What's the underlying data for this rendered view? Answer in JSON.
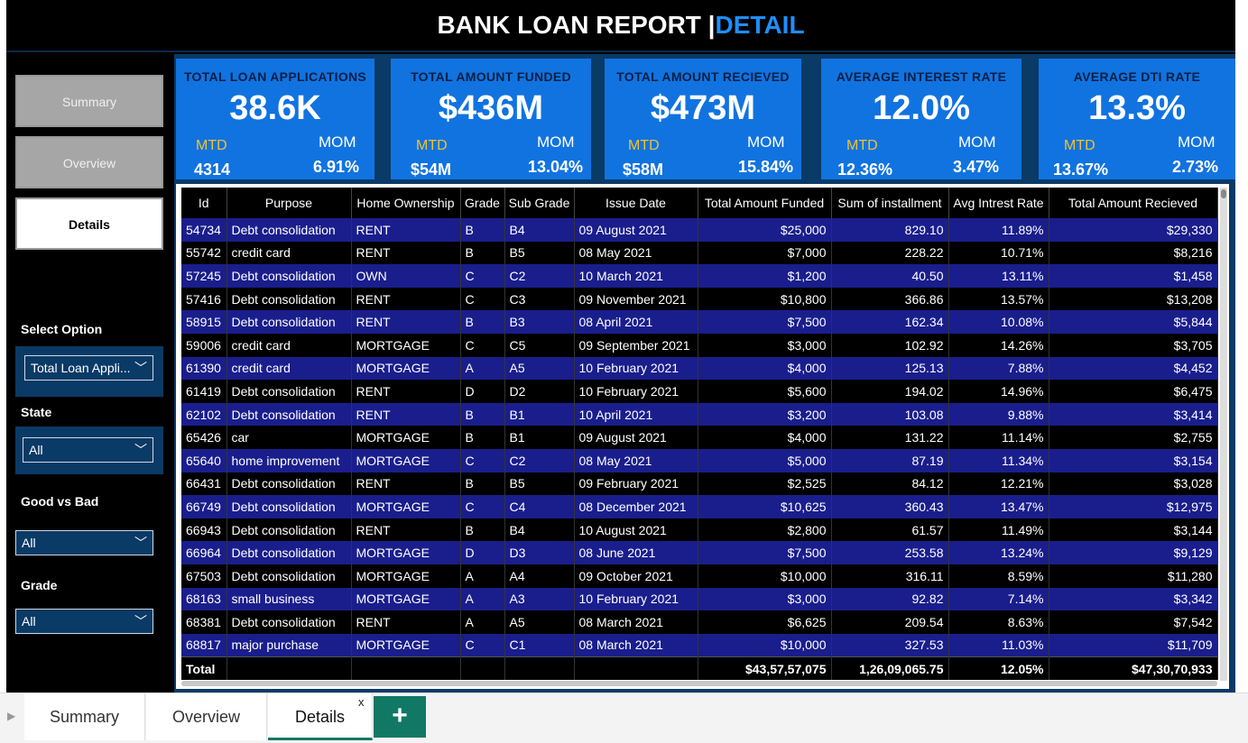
{
  "title": {
    "main": "BANK LOAN REPORT |",
    "accent": "DETAIL"
  },
  "nav": {
    "summary": "Summary",
    "overview": "Overview",
    "details": "Details"
  },
  "slicers": {
    "select_option": {
      "label": "Select Option",
      "value": "Total Loan Appli..."
    },
    "state": {
      "label": "State",
      "value": "All"
    },
    "good_bad": {
      "label": "Good vs Bad",
      "value": "All"
    },
    "grade": {
      "label": "Grade",
      "value": "All"
    }
  },
  "kpis": [
    {
      "title": "TOTAL LOAN APPLICATIONS",
      "value": "38.6K",
      "mtd_label": "MTD",
      "mtd": "4314",
      "mom_label": "MOM",
      "mom": "6.91%"
    },
    {
      "title": "TOTAL AMOUNT FUNDED",
      "value": "$436M",
      "mtd_label": "MTD",
      "mtd": "$54M",
      "mom_label": "MOM",
      "mom": "13.04%"
    },
    {
      "title": "TOTAL AMOUNT RECIEVED",
      "value": "$473M",
      "mtd_label": "MTD",
      "mtd": "$58M",
      "mom_label": "MOM",
      "mom": "15.84%"
    },
    {
      "title": "AVERAGE INTEREST RATE",
      "value": "12.0%",
      "mtd_label": "MTD",
      "mtd": "12.36%",
      "mom_label": "MOM",
      "mom": "3.47%"
    },
    {
      "title": "AVERAGE DTI RATE",
      "value": "13.3%",
      "mtd_label": "MTD",
      "mtd": "13.67%",
      "mom_label": "MOM",
      "mom": "2.73%"
    }
  ],
  "table": {
    "columns": [
      "Id",
      "Purpose",
      "Home Ownership",
      "Grade",
      "Sub Grade",
      "Issue Date",
      "Total Amount Funded",
      "Sum of installment",
      "Avg Intrest Rate",
      "Total Amount Recieved"
    ],
    "rows": [
      [
        "54734",
        "Debt consolidation",
        "RENT",
        "B",
        "B4",
        "09 August 2021",
        "$25,000",
        "829.10",
        "11.89%",
        "$29,330"
      ],
      [
        "55742",
        "credit card",
        "RENT",
        "B",
        "B5",
        "08 May 2021",
        "$7,000",
        "228.22",
        "10.71%",
        "$8,216"
      ],
      [
        "57245",
        "Debt consolidation",
        "OWN",
        "C",
        "C2",
        "10 March 2021",
        "$1,200",
        "40.50",
        "13.11%",
        "$1,458"
      ],
      [
        "57416",
        "Debt consolidation",
        "RENT",
        "C",
        "C3",
        "09 November 2021",
        "$10,800",
        "366.86",
        "13.57%",
        "$13,208"
      ],
      [
        "58915",
        "Debt consolidation",
        "RENT",
        "B",
        "B3",
        "08 April 2021",
        "$7,500",
        "162.34",
        "10.08%",
        "$5,844"
      ],
      [
        "59006",
        "credit card",
        "MORTGAGE",
        "C",
        "C5",
        "09 September 2021",
        "$3,000",
        "102.92",
        "14.26%",
        "$3,705"
      ],
      [
        "61390",
        "credit card",
        "MORTGAGE",
        "A",
        "A5",
        "10 February 2021",
        "$4,000",
        "125.13",
        "7.88%",
        "$4,452"
      ],
      [
        "61419",
        "Debt consolidation",
        "RENT",
        "D",
        "D2",
        "10 February 2021",
        "$5,600",
        "194.02",
        "14.96%",
        "$6,475"
      ],
      [
        "62102",
        "Debt consolidation",
        "RENT",
        "B",
        "B1",
        "10 April 2021",
        "$3,200",
        "103.08",
        "9.88%",
        "$3,414"
      ],
      [
        "65426",
        "car",
        "MORTGAGE",
        "B",
        "B1",
        "09 August 2021",
        "$4,000",
        "131.22",
        "11.14%",
        "$2,755"
      ],
      [
        "65640",
        "home improvement",
        "MORTGAGE",
        "C",
        "C2",
        "08 May 2021",
        "$5,000",
        "87.19",
        "11.34%",
        "$3,154"
      ],
      [
        "66431",
        "Debt consolidation",
        "RENT",
        "B",
        "B5",
        "09 February 2021",
        "$2,525",
        "84.12",
        "12.21%",
        "$3,028"
      ],
      [
        "66749",
        "Debt consolidation",
        "MORTGAGE",
        "C",
        "C4",
        "08 December 2021",
        "$10,625",
        "360.43",
        "13.47%",
        "$12,975"
      ],
      [
        "66943",
        "Debt consolidation",
        "RENT",
        "B",
        "B4",
        "10 August 2021",
        "$2,800",
        "61.57",
        "11.49%",
        "$3,144"
      ],
      [
        "66964",
        "Debt consolidation",
        "MORTGAGE",
        "D",
        "D3",
        "08 June 2021",
        "$7,500",
        "253.58",
        "13.24%",
        "$9,129"
      ],
      [
        "67503",
        "Debt consolidation",
        "MORTGAGE",
        "A",
        "A4",
        "09 October 2021",
        "$10,000",
        "316.11",
        "8.59%",
        "$11,280"
      ],
      [
        "68163",
        "small business",
        "MORTGAGE",
        "A",
        "A3",
        "10 February 2021",
        "$3,000",
        "92.82",
        "7.14%",
        "$3,342"
      ],
      [
        "68381",
        "Debt consolidation",
        "RENT",
        "A",
        "A5",
        "08 March 2021",
        "$6,625",
        "209.54",
        "8.63%",
        "$7,542"
      ],
      [
        "68817",
        "major purchase",
        "MORTGAGE",
        "C",
        "C1",
        "08 March 2021",
        "$10,000",
        "327.53",
        "11.03%",
        "$11,709"
      ]
    ],
    "total": [
      "Total",
      "",
      "",
      "",
      "",
      "",
      "$43,57,57,075",
      "1,26,09,065.75",
      "12.05%",
      "$47,30,70,933"
    ]
  },
  "tabs": {
    "summary": "Summary",
    "overview": "Overview",
    "details": "Details",
    "close": "x",
    "add": "+",
    "arrow": "▶"
  }
}
